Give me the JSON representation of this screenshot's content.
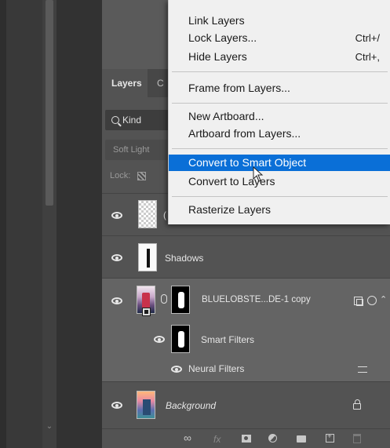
{
  "panel": {
    "tabs": [
      {
        "label": "Layers"
      },
      {
        "label": "C"
      }
    ],
    "filter": {
      "kind_label": "Kind"
    },
    "blend_mode": "Soft Light",
    "lock_label": "Lock:",
    "layers": [
      {
        "name": "(",
        "thumb": "checker",
        "visible": true
      },
      {
        "name": "Shadows",
        "thumb": "shadows",
        "visible": true
      },
      {
        "name": "BLUELOBSTE...DE-1 copy",
        "thumb": "photo",
        "visible": true,
        "selected": true
      },
      {
        "name": "Smart Filters",
        "thumb": "mask",
        "visible": true
      },
      {
        "name": "Neural Filters",
        "visible": true
      },
      {
        "name": "Background",
        "thumb": "bg",
        "visible": true,
        "locked": true
      }
    ],
    "bottom_bar": {
      "link": "∞",
      "fx": "fx"
    }
  },
  "menu": {
    "items": [
      {
        "label": "Link Layers",
        "shortcut": ""
      },
      {
        "label": "Lock Layers...",
        "shortcut": "Ctrl+/"
      },
      {
        "label": "Hide Layers",
        "shortcut": "Ctrl+,"
      },
      {
        "label": "Frame from Layers...",
        "shortcut": ""
      },
      {
        "label": "New Artboard...",
        "shortcut": ""
      },
      {
        "label": "Artboard from Layers...",
        "shortcut": ""
      },
      {
        "label": "Convert to Smart Object",
        "shortcut": "",
        "highlighted": true
      },
      {
        "label": "Convert to Layers",
        "shortcut": ""
      },
      {
        "label": "Rasterize Layers",
        "shortcut": ""
      }
    ]
  },
  "colors": {
    "highlight": "#0a6fd7",
    "panel_bg": "#535353",
    "menu_bg": "#f0f0f0"
  }
}
